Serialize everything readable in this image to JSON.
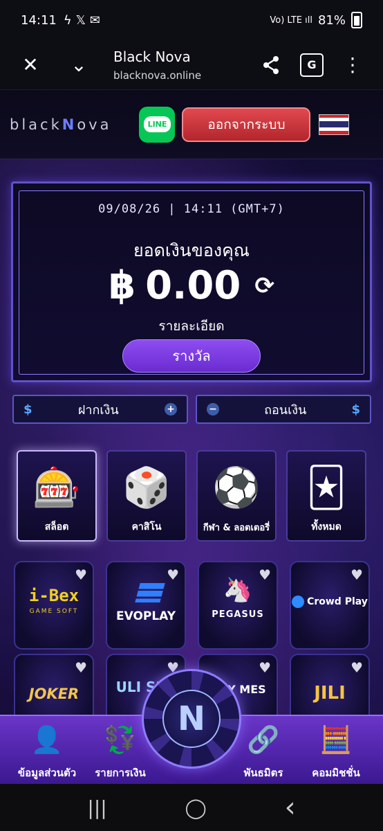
{
  "status": {
    "time": "14:11",
    "icons": "ϟ 𝕏 ✉",
    "battery": "81%",
    "signal": "Vo) LTE ıll"
  },
  "browser": {
    "title": "Black Nova",
    "url": "blacknova.online",
    "close": "✕",
    "collapse": "⌄",
    "share": "⤴",
    "translate": "G",
    "more": "⋮"
  },
  "header": {
    "logo_pre": "black",
    "logo_n": "N",
    "logo_post": "ova",
    "line": "LINE",
    "logout": "ออกจากระบบ"
  },
  "balance": {
    "datetime": "09/08/26  |  14:11 (GMT+7)",
    "label": "ยอดเงินของคุณ",
    "currency": "฿",
    "amount": "0.00",
    "details": "รายละเอียด",
    "reward": "รางวัล"
  },
  "actions": {
    "deposit": "ฝากเงิน",
    "withdraw": "ถอนเงิน",
    "coin": "$",
    "plus": "+",
    "minus": "−"
  },
  "categories": [
    {
      "label": "สล็อต",
      "art": "🎰"
    },
    {
      "label": "คาสิโน",
      "art": "🎲"
    },
    {
      "label": "กีฬา & ลอตเตอรี่",
      "art": "⚽"
    },
    {
      "label": "ทั้งหมด",
      "art": "🃏"
    }
  ],
  "providers": [
    {
      "name": "i-Bex",
      "sub": "GAME SOFT"
    },
    {
      "name": "EVOPLAY"
    },
    {
      "name": "PEGASUS"
    },
    {
      "name": "Crowd Play"
    },
    {
      "name": "JOKER"
    },
    {
      "name": "ULI SLO"
    },
    {
      "name": "NKY MES"
    },
    {
      "name": "JILI"
    }
  ],
  "nav": [
    {
      "label": "ข้อมูลส่วนตัว",
      "icon": "👤"
    },
    {
      "label": "รายการเงิน",
      "icon": "💱"
    },
    {
      "label": "พันธมิตร",
      "icon": "🔗"
    },
    {
      "label": "คอมมิชชั่น",
      "icon": "🧮"
    }
  ],
  "chip": "N",
  "sysnav": {
    "recent": "|||",
    "home": "◯",
    "back": "‹"
  }
}
